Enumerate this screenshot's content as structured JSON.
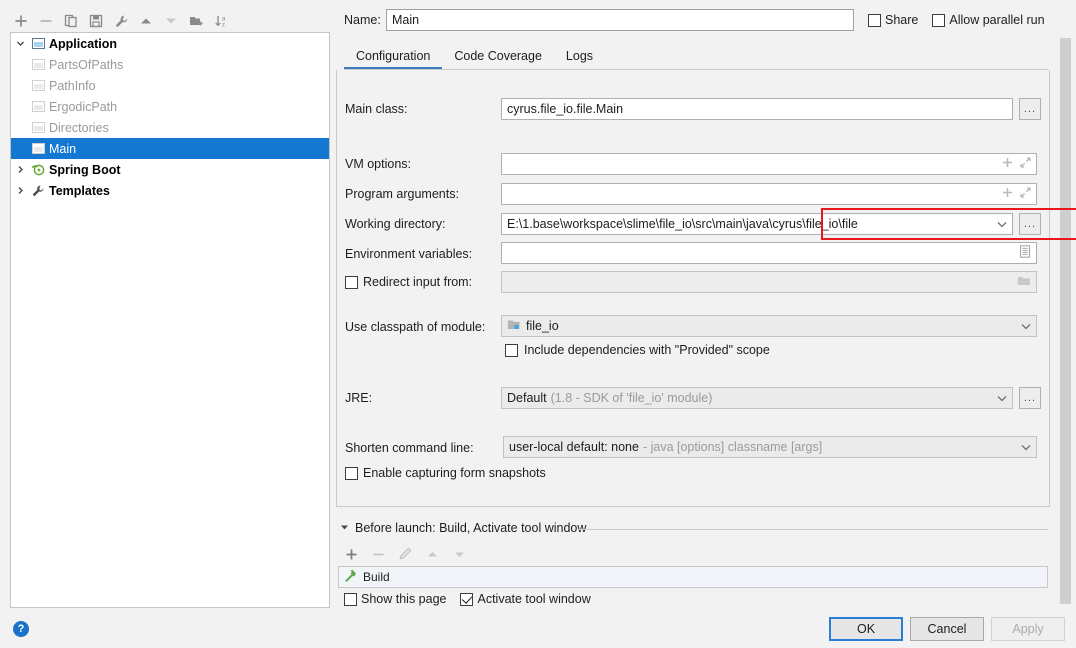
{
  "tree_toolbar": {
    "buttons": [
      {
        "name": "add-configuration-button",
        "icon": "plus-icon"
      },
      {
        "name": "remove-configuration-button",
        "icon": "minus-icon"
      },
      {
        "name": "copy-configuration-button",
        "icon": "copy-icon"
      },
      {
        "name": "save-configuration-button",
        "icon": "save-icon"
      },
      {
        "name": "edit-templates-button",
        "icon": "wrench-icon"
      },
      {
        "name": "move-up-button",
        "icon": "arrow-up-icon"
      },
      {
        "name": "move-down-button",
        "icon": "arrow-down-icon"
      },
      {
        "name": "new-folder-button",
        "icon": "folder-add-icon"
      },
      {
        "name": "sort-alphabetically-button",
        "icon": "sort-az-icon"
      }
    ]
  },
  "tree": {
    "items": [
      {
        "label": "Application",
        "level": 0,
        "type": "group",
        "expanded": true,
        "icon": "application-window-icon",
        "selected": false
      },
      {
        "label": "PartsOfPaths",
        "level": 1,
        "type": "child",
        "icon": "run-config-icon",
        "selected": false
      },
      {
        "label": "PathInfo",
        "level": 1,
        "type": "child",
        "icon": "run-config-icon",
        "selected": false
      },
      {
        "label": "ErgodicPath",
        "level": 1,
        "type": "child",
        "icon": "run-config-icon",
        "selected": false
      },
      {
        "label": "Directories",
        "level": 1,
        "type": "child",
        "icon": "run-config-icon",
        "selected": false
      },
      {
        "label": "Main",
        "level": 1,
        "type": "child",
        "icon": "run-config-icon",
        "selected": true
      },
      {
        "label": "Spring Boot",
        "level": 0,
        "type": "group",
        "expanded": false,
        "icon": "spring-boot-icon",
        "selected": false
      },
      {
        "label": "Templates",
        "level": 0,
        "type": "group",
        "expanded": false,
        "icon": "wrench-icon",
        "selected": false
      }
    ]
  },
  "header": {
    "name_label": "Name:",
    "name_value": "Main",
    "share_label": "Share",
    "share_checked": false,
    "allow_parallel_label": "Allow parallel run",
    "allow_parallel_checked": false
  },
  "tabs": [
    {
      "label": "Configuration",
      "active": true
    },
    {
      "label": "Code Coverage",
      "active": false
    },
    {
      "label": "Logs",
      "active": false
    }
  ],
  "form": {
    "main_class": {
      "label": "Main class:",
      "value": "cyrus.file_io.file.Main",
      "browse": "..."
    },
    "vm_options": {
      "label": "VM options:",
      "value": "",
      "icons": [
        "plus-icon",
        "expand-icon"
      ]
    },
    "program_arguments": {
      "label": "Program arguments:",
      "value": "",
      "icons": [
        "plus-icon",
        "expand-icon"
      ]
    },
    "working_directory": {
      "label": "Working directory:",
      "value": "E:\\1.base\\workspace\\slime\\file_io\\src\\main\\java\\cyrus\\file_io\\file",
      "browse": "...",
      "highlight_color": "#e8181c"
    },
    "environment_variables": {
      "label": "Environment variables:",
      "value": "",
      "icon": "env-list-icon"
    },
    "redirect_input": {
      "label": "Redirect input from:",
      "checked": false,
      "value": "",
      "icon": "folder-icon"
    },
    "use_classpath_of_module": {
      "label": "Use classpath of module:",
      "value": "file_io",
      "icon": "module-icon"
    },
    "include_provided": {
      "label": "Include dependencies with \"Provided\" scope",
      "checked": false
    },
    "jre": {
      "label": "JRE:",
      "value": "Default",
      "hint": "(1.8 - SDK of 'file_io' module)",
      "browse": "..."
    },
    "shorten_command_line": {
      "label": "Shorten command line:",
      "value": "user-local default: none",
      "hint": "- java [options] classname [args]"
    },
    "enable_form_snapshots": {
      "label": "Enable capturing form snapshots",
      "checked": false
    }
  },
  "before_launch": {
    "title": "Before launch: Build, Activate tool window",
    "expanded": true,
    "toolbar": [
      {
        "name": "add-task-button",
        "icon": "plus-icon",
        "enabled": true
      },
      {
        "name": "remove-task-button",
        "icon": "minus-icon",
        "enabled": false
      },
      {
        "name": "edit-task-button",
        "icon": "pencil-icon",
        "enabled": false
      },
      {
        "name": "move-task-up-button",
        "icon": "arrow-up-icon",
        "enabled": false
      },
      {
        "name": "move-task-down-button",
        "icon": "arrow-down-icon",
        "enabled": false
      }
    ],
    "tasks": [
      {
        "label": "Build",
        "icon": "build-hammer-icon"
      }
    ],
    "show_this_page": {
      "label": "Show this page",
      "checked": false
    },
    "activate_tool_window": {
      "label": "Activate tool window",
      "checked": true
    }
  },
  "footer": {
    "help_icon": "help-icon",
    "ok_label": "OK",
    "cancel_label": "Cancel",
    "apply_label": "Apply",
    "apply_enabled": false
  }
}
